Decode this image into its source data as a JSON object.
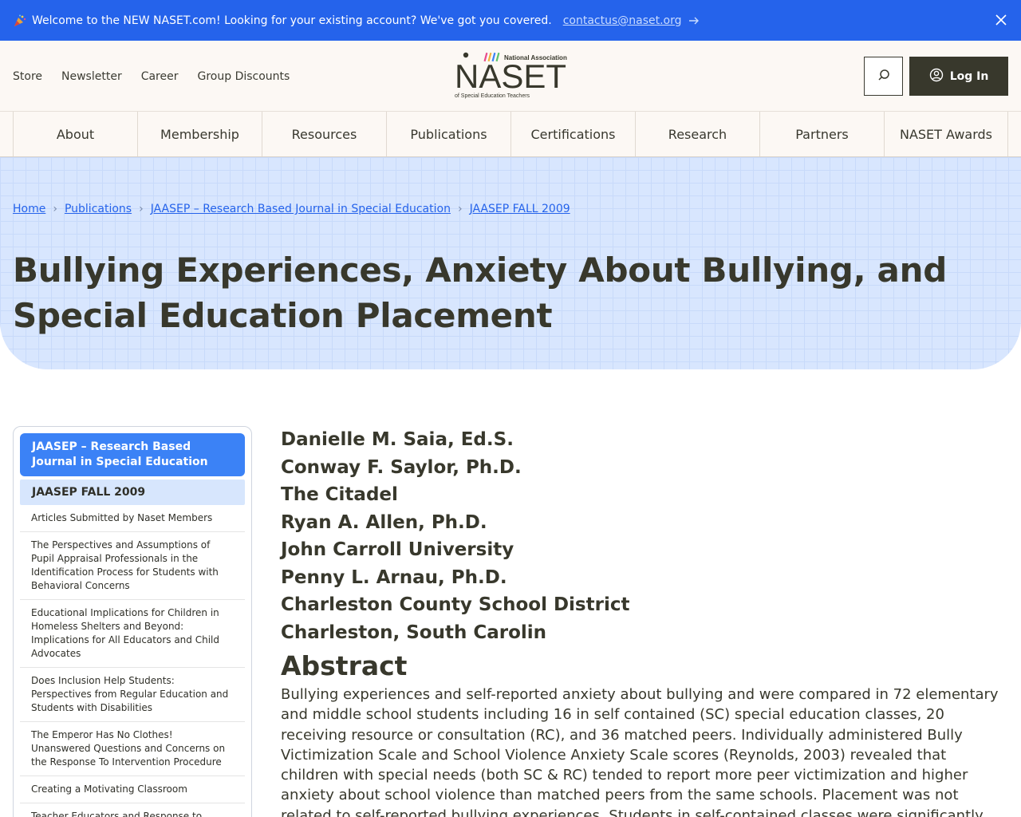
{
  "announcement": {
    "message": "Welcome to the NEW NASET.com! Looking for your existing account? We've got you covered.",
    "email": "contactus@naset.org"
  },
  "header": {
    "util_links": [
      "Store",
      "Newsletter",
      "Career",
      "Group Discounts"
    ],
    "logo": {
      "top": "National Association",
      "main": "NASET",
      "bottom": "of Special Education Teachers"
    },
    "login_label": "Log In"
  },
  "nav": {
    "items": [
      "About",
      "Membership",
      "Resources",
      "Publications",
      "Certifications",
      "Research",
      "Partners",
      "NASET Awards"
    ]
  },
  "breadcrumb": [
    "Home",
    "Publications",
    "JAASEP – Research Based Journal in Special Education",
    "JAASEP FALL 2009"
  ],
  "page_title": "Bullying Experiences, Anxiety About Bullying, and Special Education Placement",
  "sidebar": {
    "heading": "JAASEP – Research Based Journal in Special Education",
    "subheading": "JAASEP FALL 2009",
    "items": [
      "Articles Submitted by Naset Members",
      "The Perspectives and Assumptions of Pupil Appraisal Professionals in the Identification Process for Students with Behavioral Concerns",
      "Educational Implications for Children in Homeless Shelters and Beyond: Implications for All Educators and Child Advocates",
      "Does Inclusion Help Students: Perspectives from Regular Education and Students with Disabilities",
      "The Emperor Has No Clothes! Unanswered Questions and Concerns on the Response To Intervention Procedure",
      "Creating a Motivating Classroom",
      "Teacher Educators and Response to Intervention: A Survey of Knowledge"
    ]
  },
  "content": {
    "authors": [
      "Danielle M. Saia, Ed.S.",
      "Conway F. Saylor, Ph.D.",
      "The Citadel",
      "Ryan A. Allen, Ph.D.",
      "John Carroll University",
      "Penny  L. Arnau, Ph.D.",
      "Charleston County School District",
      "Charleston, South Carolin"
    ],
    "abstract_title": "Abstract",
    "abstract_text": "Bullying experiences and self-reported anxiety about bullying and were compared in 72 elementary and middle school students including 16 in self contained (SC) special education classes, 20 receiving resource or consultation (RC), and 36 matched peers. Individually administered Bully Victimization Scale and School Violence Anxiety Scale scores (Reynolds, 2003) revealed that children with special needs (both SC & RC) tended to report more peer victimization and higher anxiety about school violence than matched peers from the same schools. Placement was not related to self-reported bullying experiences. Students in self-contained classes were significantly more anxious about possible bullying, especially"
  },
  "colors": {
    "announce_bg": "#2563eb",
    "header_bg": "#fcf8f4",
    "hero_bg": "#d8e6fe",
    "accent": "#3b82f6",
    "dark": "#38382c"
  }
}
